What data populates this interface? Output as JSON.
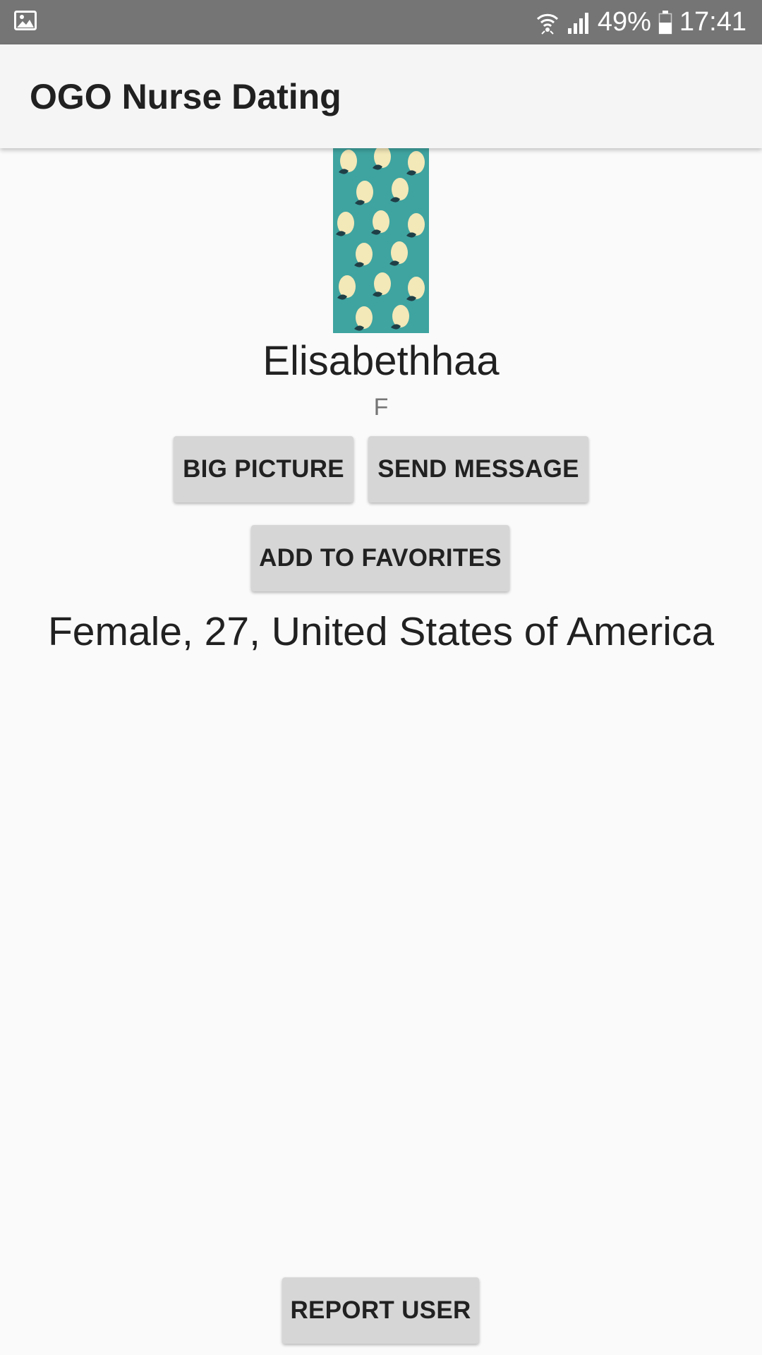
{
  "status_bar": {
    "battery": "49%",
    "time": "17:41",
    "icons": [
      "gallery-notification-icon",
      "wifi-icon",
      "signal-icon",
      "battery-icon"
    ]
  },
  "app_bar": {
    "title": "OGO Nurse Dating"
  },
  "profile": {
    "name": "Elisabethhaa",
    "gender_letter": "F",
    "details": "Female, 27, United States of America"
  },
  "actions": {
    "big_picture": "BIG PICTURE",
    "send_message": "SEND MESSAGE",
    "add_to_favorites": "ADD TO FAVORITES",
    "report_user": "REPORT USER"
  },
  "colors": {
    "status_bar": "#757575",
    "app_bar": "#f5f5f5",
    "background": "#fafafa",
    "button": "#d6d6d6",
    "photo_teal": "#3fa4a0"
  }
}
